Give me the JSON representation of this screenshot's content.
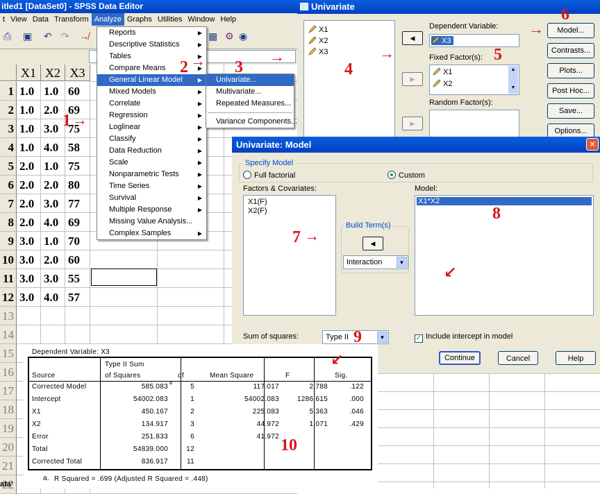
{
  "editor": {
    "title": "itled1 [DataSet0] - SPSS Data Editor",
    "menu": [
      "t",
      "View",
      "Data",
      "Transform",
      "Analyze",
      "Graphs",
      "Utilities",
      "Window",
      "Help"
    ],
    "columns": [
      "X1",
      "X2",
      "X3"
    ],
    "row_numbers": [
      "1",
      "2",
      "3",
      "4",
      "5",
      "6",
      "7",
      "8",
      "9",
      "10",
      "11",
      "12",
      "13",
      "14",
      "15",
      "16",
      "17",
      "18",
      "19",
      "20",
      "21",
      "22"
    ],
    "rows": [
      [
        "1.0",
        "1.0",
        "60"
      ],
      [
        "1.0",
        "2.0",
        "69"
      ],
      [
        "1.0",
        "3.0",
        "75"
      ],
      [
        "1.0",
        "4.0",
        "58"
      ],
      [
        "2.0",
        "1.0",
        "75"
      ],
      [
        "2.0",
        "2.0",
        "80"
      ],
      [
        "2.0",
        "3.0",
        "77"
      ],
      [
        "2.0",
        "4.0",
        "69"
      ],
      [
        "3.0",
        "1.0",
        "70"
      ],
      [
        "3.0",
        "2.0",
        "60"
      ],
      [
        "3.0",
        "3.0",
        "55"
      ],
      [
        "3.0",
        "4.0",
        "57"
      ]
    ],
    "bottom_text": "ata'"
  },
  "analyze_menu": [
    "Reports",
    "Descriptive Statistics",
    "Tables",
    "Compare Means",
    "General Linear Model",
    "Mixed Models",
    "Correlate",
    "Regression",
    "Loglinear",
    "Classify",
    "Data Reduction",
    "Scale",
    "Nonparametric Tests",
    "Time Series",
    "Survival",
    "Multiple Response",
    "Missing Value Analysis...",
    "Complex Samples"
  ],
  "glm_submenu": [
    "Univariate...",
    "Multivariate...",
    "Repeated Measures...",
    "Variance Components..."
  ],
  "univariate": {
    "title": "Univariate",
    "variables": [
      "X1",
      "X2",
      "X3"
    ],
    "dependent_label": "Dependent Variable:",
    "dependent_value": "X3",
    "fixed_label": "Fixed Factor(s):",
    "fixed_values": [
      "X1",
      "X2"
    ],
    "random_label": "Random Factor(s):",
    "buttons": [
      "Model...",
      "Contrasts...",
      "Plots...",
      "Post Hoc...",
      "Save...",
      "Options..."
    ]
  },
  "model": {
    "title": "Univariate: Model",
    "specify_label": "Specify Model",
    "full_factorial": "Full factorial",
    "custom": "Custom",
    "factors_label": "Factors & Covariates:",
    "factors": [
      "X1(F)",
      "X2(F)"
    ],
    "model_label": "Model:",
    "model_terms": [
      "X1*X2"
    ],
    "build_term": "Build Term(s)",
    "build_type": "Interaction",
    "ss_label": "Sum of squares:",
    "ss_value": "Type II",
    "intercept_label": "Include intercept in model",
    "buttons": [
      "Continue",
      "Cancel",
      "Help"
    ]
  },
  "anova": {
    "dependent": "Dependent Variable: X3",
    "headers": {
      "source": "Source",
      "ss1": "Type II Sum",
      "ss2": "of Squares",
      "df": "df",
      "ms": "Mean Square",
      "f": "F",
      "sig": "Sig."
    },
    "rows": [
      {
        "source": "Corrected Model",
        "ss": "585.083",
        "sup": "a",
        "df": "5",
        "ms": "117.017",
        "f": "2.788",
        "sig": ".122"
      },
      {
        "source": "Intercept",
        "ss": "54002.083",
        "sup": "",
        "df": "1",
        "ms": "54002.083",
        "f": "1286.615",
        "sig": ".000"
      },
      {
        "source": "X1",
        "ss": "450.167",
        "sup": "",
        "df": "2",
        "ms": "225.083",
        "f": "5.363",
        "sig": ".046"
      },
      {
        "source": "X2",
        "ss": "134.917",
        "sup": "",
        "df": "3",
        "ms": "44.972",
        "f": "1.071",
        "sig": ".429"
      },
      {
        "source": "Error",
        "ss": "251.833",
        "sup": "",
        "df": "6",
        "ms": "41.972",
        "f": "",
        "sig": ""
      },
      {
        "source": "Total",
        "ss": "54839.000",
        "sup": "",
        "df": "12",
        "ms": "",
        "f": "",
        "sig": ""
      },
      {
        "source": "Corrected Total",
        "ss": "836.917",
        "sup": "",
        "df": "11",
        "ms": "",
        "f": "",
        "sig": ""
      }
    ],
    "footnote_mark": "a.",
    "footnote": "R Squared = .699 (Adjusted R Squared = .448)"
  },
  "annotations": {
    "step_labels": [
      "1",
      "2",
      "3",
      "4",
      "5",
      "6",
      "7",
      "8",
      "9",
      "10"
    ],
    "arrow_right": "→",
    "arrow_down_left": "↙",
    "color": "#d4161c"
  },
  "colors": {
    "titlebar": "#0040c0",
    "menu_highlight": "#316ac5",
    "dialog_bg": "#ece9d8"
  }
}
